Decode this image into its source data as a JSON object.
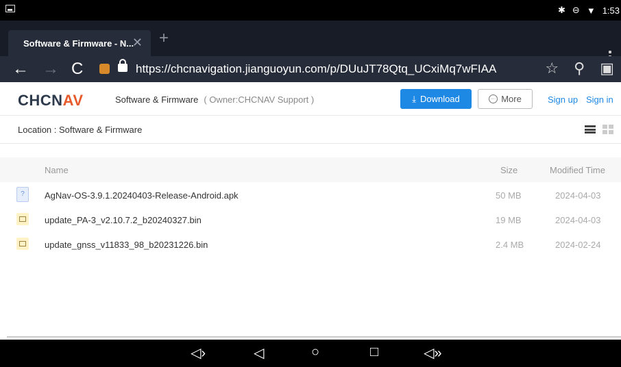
{
  "status_bar": {
    "time": "1:53"
  },
  "browser": {
    "tab_title": "Software & Firmware - N...",
    "tab_close": "✕",
    "new_tab": "+",
    "url": "https://chcnavigation.jianguoyun.com/p/DUuJT78Qtq_UCxiMq7wFIAA"
  },
  "header": {
    "logo": "CHCNAV",
    "title": "Software & Firmware",
    "owner": "( Owner:CHCNAV Support )",
    "download_label": "Download",
    "more_label": "More",
    "signup_label": "Sign up",
    "signin_label": "Sign in"
  },
  "location": {
    "text": "Location : Software & Firmware"
  },
  "table": {
    "headers": {
      "name": "Name",
      "size": "Size",
      "modified": "Modified Time"
    },
    "rows": [
      {
        "name": "AgNav-OS-3.9.1.20240403-Release-Android.apk",
        "size": "50 MB",
        "modified": "2024-04-03",
        "icon": "apk-file-icon"
      },
      {
        "name": "update_PA-3_v2.10.7.2_b20240327.bin",
        "size": "19 MB",
        "modified": "2024-04-03",
        "icon": "bin-file-icon"
      },
      {
        "name": "update_gnss_v11833_98_b20231226.bin",
        "size": "2.4 MB",
        "modified": "2024-02-24",
        "icon": "bin-file-icon"
      }
    ]
  },
  "colors": {
    "accent": "#1e88e5",
    "logo_accent": "#e65a2b",
    "browser_bg": "#262c3a"
  }
}
